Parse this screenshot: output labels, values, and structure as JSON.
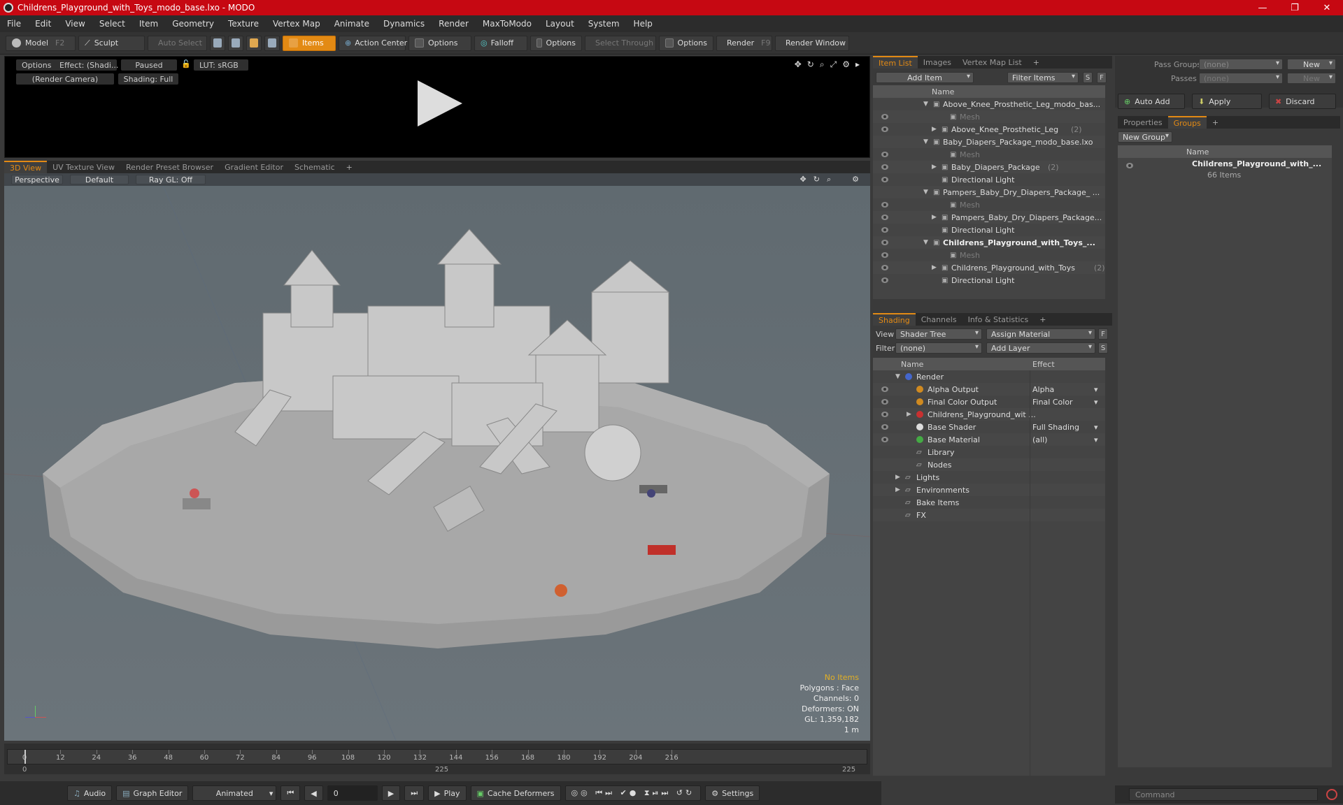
{
  "window": {
    "title": "Childrens_Playground_with_Toys_modo_base.lxo - MODO",
    "minimize": "—",
    "maximize": "❐",
    "close": "✕"
  },
  "menu": [
    "File",
    "Edit",
    "View",
    "Select",
    "Item",
    "Geometry",
    "Texture",
    "Vertex Map",
    "Animate",
    "Dynamics",
    "Render",
    "MaxToModo",
    "Layout",
    "System",
    "Help"
  ],
  "toolbar": {
    "model": "Model",
    "model_key": "F2",
    "sculpt": "Sculpt",
    "auto_select": "Auto Select",
    "items": "Items",
    "action_center": "Action Center",
    "options1": "Options",
    "falloff": "Falloff",
    "options2": "Options",
    "select_through": "Select Through",
    "options3": "Options",
    "render": "Render",
    "render_key": "F9",
    "render_window": "Render Window"
  },
  "render_preview": {
    "options": "Options",
    "effect": "Effect: (Shadi...",
    "paused": "Paused",
    "lut": "LUT: sRGB",
    "camera": "(Render Camera)",
    "shading": "Shading: Full"
  },
  "viewport_tabs": [
    "3D View",
    "UV Texture View",
    "Render Preset Browser",
    "Gradient Editor",
    "Schematic"
  ],
  "viewport": {
    "perspective": "Perspective",
    "default": "Default",
    "raygl": "Ray GL: Off"
  },
  "stats": {
    "items": "No Items",
    "polygons": "Polygons : Face",
    "channels": "Channels: 0",
    "deformers": "Deformers: ON",
    "gl": "GL: 1,359,182",
    "scale": "1 m"
  },
  "timeline": {
    "labels": [
      "0",
      "12",
      "24",
      "36",
      "48",
      "60",
      "72",
      "84",
      "96",
      "108",
      "120",
      "132",
      "144",
      "156",
      "168",
      "180",
      "192",
      "204",
      "216"
    ],
    "start": "0",
    "mid": "225",
    "end": "225"
  },
  "bottom": {
    "audio": "Audio",
    "graph_editor": "Graph Editor",
    "animated": "Animated",
    "frame": "0",
    "play": "Play",
    "cache": "Cache Deformers",
    "settings": "Settings"
  },
  "item_list": {
    "tabs": [
      "Item List",
      "Images",
      "Vertex Map List"
    ],
    "add_item": "Add Item",
    "filter": "Filter Items",
    "s": "S",
    "f": "F",
    "col_name": "Name",
    "rows": [
      {
        "t": "Above_Knee_Prosthetic_Leg_modo_bas...",
        "indent": 0,
        "arrow": "▼",
        "bold": false,
        "eye": false
      },
      {
        "t": "Mesh",
        "indent": 2,
        "arrow": "",
        "bold": false,
        "eye": true,
        "gray": true
      },
      {
        "t": "Above_Knee_Prosthetic_Leg",
        "cnt": "(2)",
        "indent": 1,
        "arrow": "▶",
        "bold": false,
        "eye": true
      },
      {
        "t": "Baby_Diapers_Package_modo_base.lxo",
        "indent": 0,
        "arrow": "▼",
        "bold": false,
        "eye": false
      },
      {
        "t": "Mesh",
        "indent": 2,
        "arrow": "",
        "bold": false,
        "eye": true,
        "gray": true
      },
      {
        "t": "Baby_Diapers_Package",
        "cnt": "(2)",
        "indent": 1,
        "arrow": "▶",
        "bold": false,
        "eye": true
      },
      {
        "t": "Directional Light",
        "indent": 1,
        "arrow": "",
        "bold": false,
        "eye": true
      },
      {
        "t": "Pampers_Baby_Dry_Diapers_Package_ ...",
        "indent": 0,
        "arrow": "▼",
        "bold": false,
        "eye": false
      },
      {
        "t": "Mesh",
        "indent": 2,
        "arrow": "",
        "bold": false,
        "eye": true,
        "gray": true
      },
      {
        "t": "Pampers_Baby_Dry_Diapers_Package...",
        "indent": 1,
        "arrow": "▶",
        "bold": false,
        "eye": true
      },
      {
        "t": "Directional Light",
        "indent": 1,
        "arrow": "",
        "bold": false,
        "eye": true
      },
      {
        "t": "Childrens_Playground_with_Toys_...",
        "indent": 0,
        "arrow": "▼",
        "bold": true,
        "eye": true
      },
      {
        "t": "Mesh",
        "indent": 2,
        "arrow": "",
        "bold": false,
        "eye": true,
        "gray": true
      },
      {
        "t": "Childrens_Playground_with_Toys",
        "cnt": "(2)",
        "indent": 1,
        "arrow": "▶",
        "bold": false,
        "eye": true
      },
      {
        "t": "Directional Light",
        "indent": 1,
        "arrow": "",
        "bold": false,
        "eye": true
      }
    ]
  },
  "shading": {
    "tabs": [
      "Shading",
      "Channels",
      "Info & Statistics"
    ],
    "view_label": "View",
    "view_value": "Shader Tree",
    "assign": "Assign Material",
    "filter_label": "Filter",
    "filter_value": "(none)",
    "add_layer": "Add Layer",
    "f": "F",
    "s": "S",
    "col_name": "Name",
    "col_effect": "Effect",
    "rows": [
      {
        "t": "Render",
        "effect": "",
        "indent": 0,
        "arrow": "▼",
        "eye": false,
        "dot": "#4466cc"
      },
      {
        "t": "Alpha Output",
        "effect": "Alpha",
        "indent": 1,
        "arrow": "",
        "eye": true,
        "dot": "#d08a20"
      },
      {
        "t": "Final Color Output",
        "effect": "Final Color",
        "indent": 1,
        "arrow": "",
        "eye": true,
        "dot": "#d08a20"
      },
      {
        "t": "Childrens_Playground_wit ...",
        "effect": "",
        "indent": 1,
        "arrow": "▶",
        "eye": true,
        "dot": "#c83030"
      },
      {
        "t": "Base Shader",
        "effect": "Full Shading",
        "indent": 1,
        "arrow": "",
        "eye": true,
        "dot": "#dddddd"
      },
      {
        "t": "Base Material",
        "effect": "(all)",
        "indent": 1,
        "arrow": "",
        "eye": true,
        "dot": "#44aa44"
      },
      {
        "t": "Library",
        "effect": "",
        "indent": 1,
        "arrow": "",
        "eye": false,
        "dot": ""
      },
      {
        "t": "Nodes",
        "effect": "",
        "indent": 1,
        "arrow": "",
        "eye": false,
        "dot": ""
      },
      {
        "t": "Lights",
        "effect": "",
        "indent": 0,
        "arrow": "▶",
        "eye": false,
        "dot": ""
      },
      {
        "t": "Environments",
        "effect": "",
        "indent": 0,
        "arrow": "▶",
        "eye": false,
        "dot": ""
      },
      {
        "t": "Bake Items",
        "effect": "",
        "indent": 0,
        "arrow": "",
        "eye": false,
        "dot": ""
      },
      {
        "t": "FX",
        "effect": "",
        "indent": 0,
        "arrow": "",
        "eye": false,
        "dot": ""
      }
    ]
  },
  "groups": {
    "pass_groups": "Pass Groups",
    "passes": "Passes",
    "none": "(none)",
    "new": "New",
    "auto_add": "Auto Add",
    "apply": "Apply",
    "discard": "Discard",
    "tabs": [
      "Properties",
      "Groups"
    ],
    "new_group": "New Group",
    "col_name": "Name",
    "group_name": "Childrens_Playground_with_...",
    "group_count": "66 Items",
    "command": "Command"
  }
}
